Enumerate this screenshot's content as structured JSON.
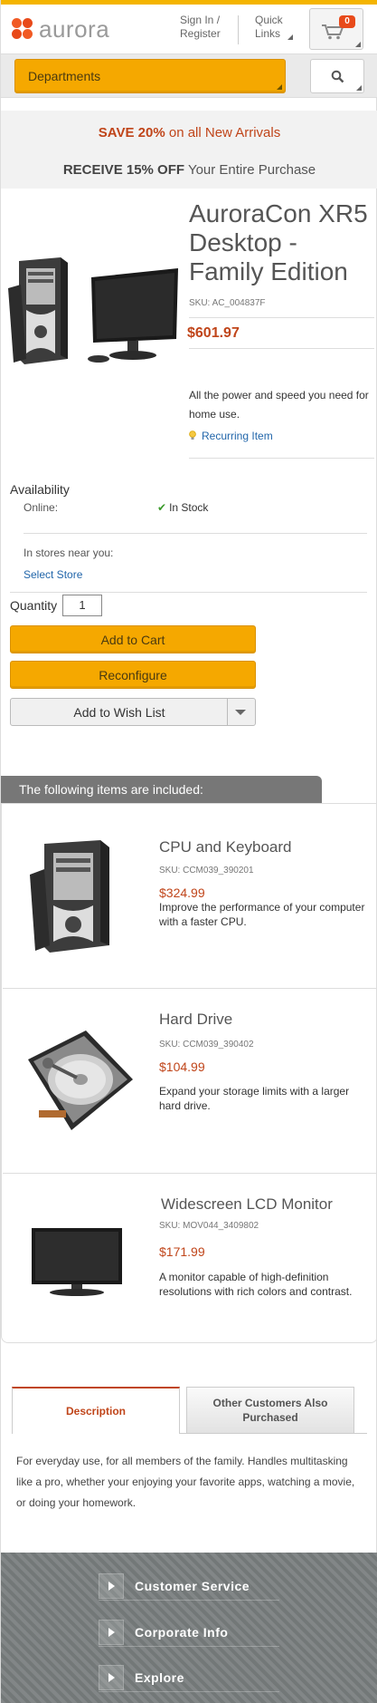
{
  "header": {
    "logo_text": "aurora",
    "sign_in": "Sign In / Register",
    "quick_links": "Quick Links",
    "cart_count": "0"
  },
  "search": {
    "departments_label": "Departments"
  },
  "promos": {
    "promo1_bold": "SAVE 20%",
    "promo1_rest": " on all New Arrivals",
    "promo2_bold": "RECEIVE 15% OFF",
    "promo2_rest": " Your Entire Purchase"
  },
  "product": {
    "title": "AuroraCon XR5 Desktop - Family Edition",
    "sku": "SKU: AC_004837F",
    "price": "$601.97",
    "description": "All the power and speed you need for home use.",
    "recurring": "Recurring Item"
  },
  "availability": {
    "title": "Availability",
    "online_label": "Online:",
    "online_status": "In Stock",
    "stores_label": "In stores near you:",
    "select_store": "Select Store"
  },
  "purchase": {
    "quantity_label": "Quantity",
    "quantity_value": "1",
    "add_to_cart": "Add to Cart",
    "reconfigure": "Reconfigure",
    "add_to_wishlist": "Add to Wish List"
  },
  "included": {
    "heading": "The following items are included:",
    "items": [
      {
        "name": "CPU and Keyboard",
        "sku": "SKU: CCM039_390201",
        "price": "$324.99",
        "description": "Improve the performance of your computer with a faster CPU.",
        "icon": "desktop-tower-icon"
      },
      {
        "name": "Hard Drive",
        "sku": "SKU: CCM039_390402",
        "price": "$104.99",
        "description": "Expand your storage limits with a larger hard drive.",
        "icon": "hard-drive-icon"
      },
      {
        "name": "Widescreen LCD Monitor",
        "sku": "SKU: MOV044_3409802",
        "price": "$171.99",
        "description": "A monitor capable of high-definition resolutions with rich colors and contrast.",
        "icon": "monitor-icon"
      }
    ]
  },
  "tabs": {
    "description": "Description",
    "other_customers": "Other Customers Also Purchased",
    "description_text": "For everyday use, for all members of the family. Handles multitasking like a pro, whether your enjoying your favorite apps, watching a movie, or doing your homework."
  },
  "footer": {
    "links": [
      "Customer Service",
      "Corporate Info",
      "Explore"
    ]
  },
  "colors": {
    "accent": "#f5a800",
    "price": "#c0451a",
    "link": "#2266aa"
  }
}
